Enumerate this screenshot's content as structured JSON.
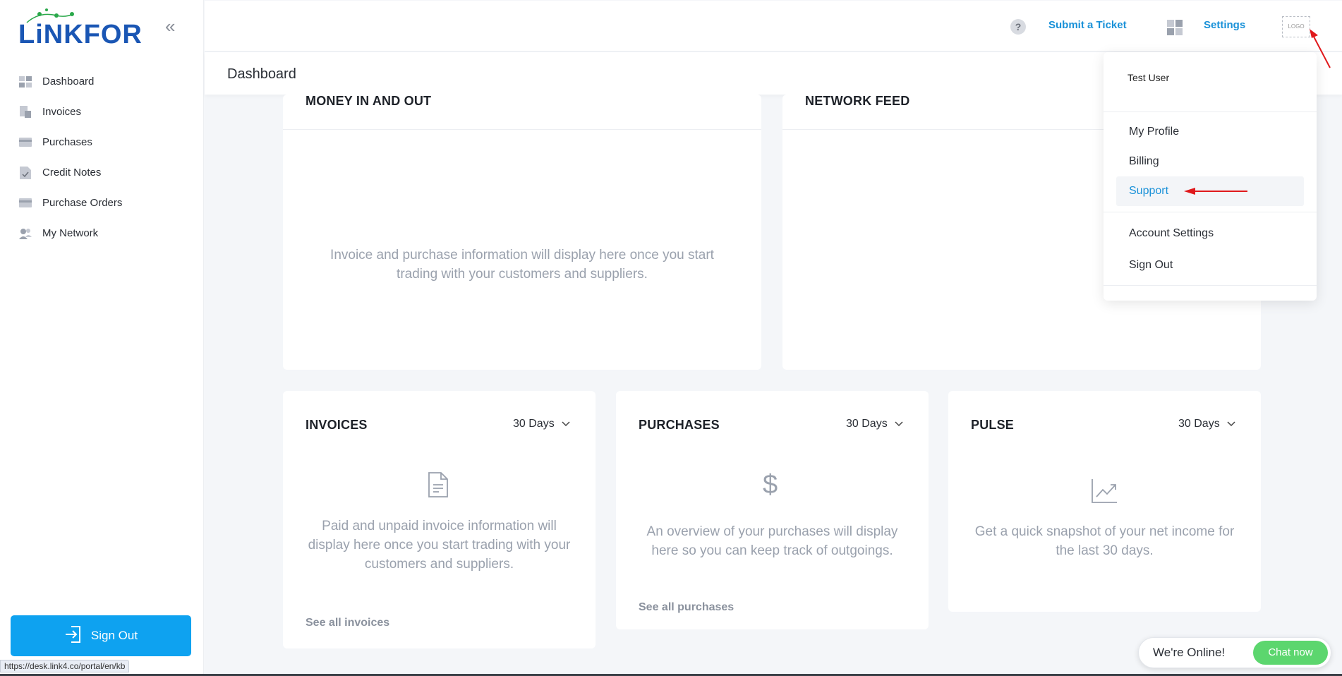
{
  "brand": {
    "logo_text": "LiNKFOR"
  },
  "sidebar": {
    "items": [
      {
        "label": "Dashboard"
      },
      {
        "label": "Invoices"
      },
      {
        "label": "Purchases"
      },
      {
        "label": "Credit Notes"
      },
      {
        "label": "Purchase Orders"
      },
      {
        "label": "My Network"
      }
    ],
    "sign_out": "Sign Out"
  },
  "status_url": "https://desk.link4.co/portal/en/kb",
  "header": {
    "help_glyph": "?",
    "submit_ticket": "Submit a Ticket",
    "settings": "Settings",
    "logo_placeholder": "LOGO"
  },
  "page": {
    "title": "Dashboard"
  },
  "cards": {
    "money": {
      "title": "MONEY IN AND OUT",
      "empty": "Invoice and purchase information will display here once you start trading with your customers and suppliers."
    },
    "network": {
      "title": "NETWORK FEED"
    },
    "invoices": {
      "title": "INVOICES",
      "period": "30 Days",
      "empty": "Paid and unpaid invoice information will display here once you start trading with your customers and suppliers.",
      "link": "See all invoices"
    },
    "purchases": {
      "title": "PURCHASES",
      "period": "30 Days",
      "empty": "An overview of your purchases will display here so you can keep track of outgoings.",
      "link": "See all purchases",
      "icon_glyph": "$"
    },
    "pulse": {
      "title": "PULSE",
      "period": "30 Days",
      "empty": "Get a quick snapshot of your net income for the last 30 days."
    }
  },
  "user_menu": {
    "user_name": "Test User",
    "items": [
      "My Profile",
      "Billing",
      "Support",
      "Account Settings",
      "Sign Out"
    ],
    "active_item": "Support"
  },
  "chat": {
    "status": "We're Online!",
    "button": "Chat now"
  },
  "colors": {
    "accent": "#1991d8",
    "primary_button": "#0ea2f0",
    "chat_button": "#5cd66e",
    "brand": "#1a56b4",
    "annotation": "#e0191c"
  }
}
